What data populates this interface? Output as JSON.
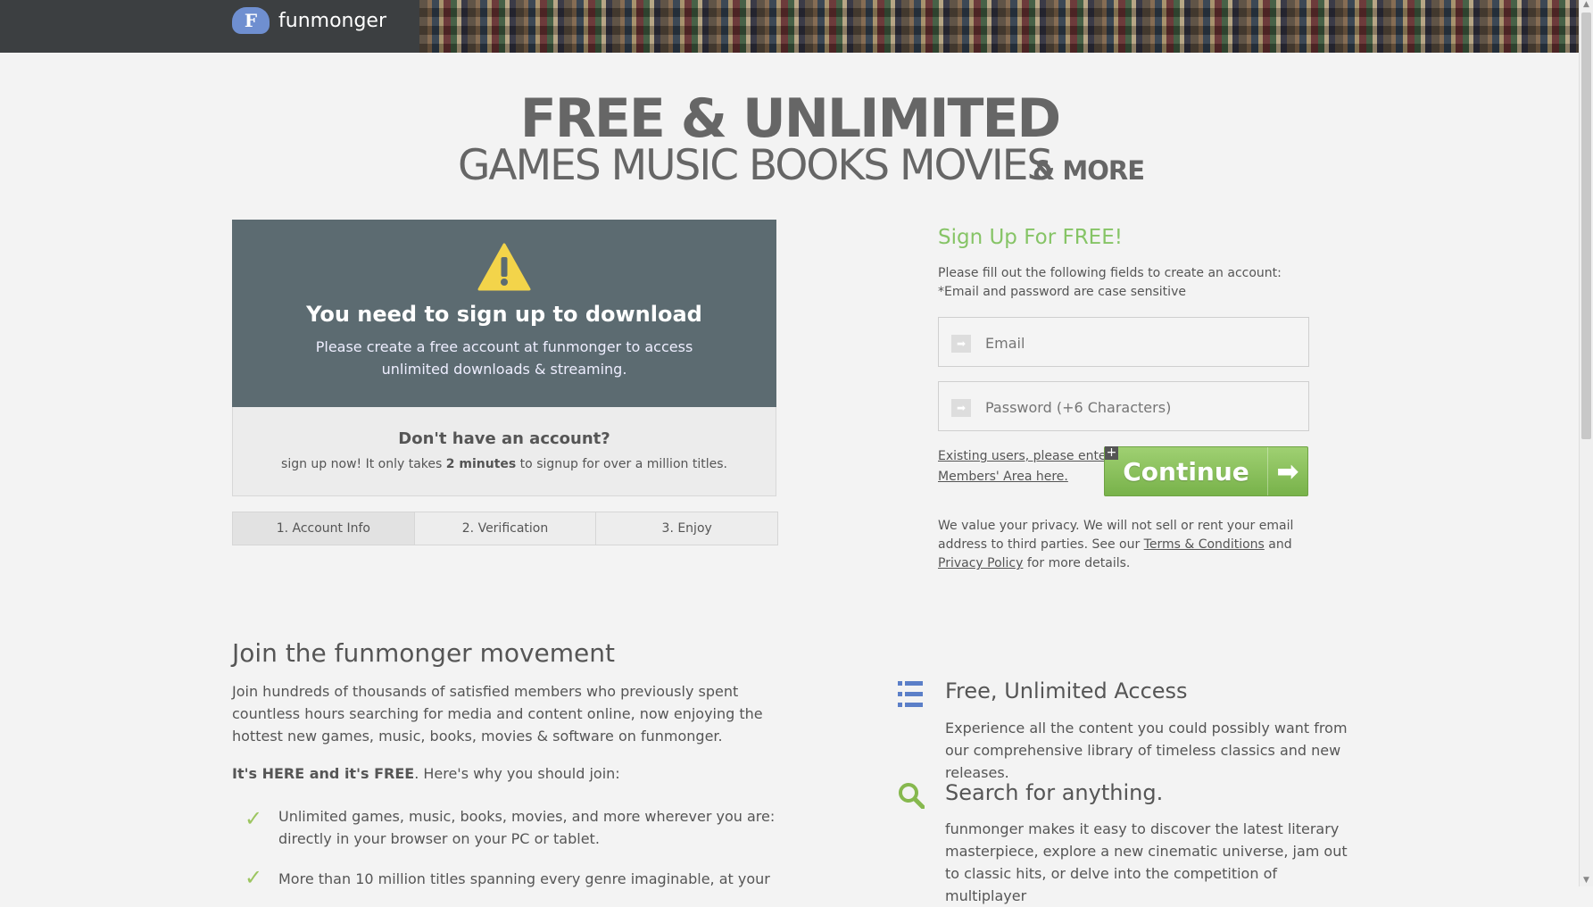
{
  "header": {
    "logo_letter": "F",
    "brand": "funmonger"
  },
  "hero": {
    "line1": "FREE & UNLIMITED",
    "line2": "GAMES MUSIC BOOKS MOVIES",
    "line3": "& MORE"
  },
  "notice": {
    "title": "You need to sign up to download",
    "subtitle_1": "Please create a free account at funmonger to access",
    "subtitle_2": "unlimited downloads & streaming.",
    "question": "Don't have an account?",
    "sub_pre": "sign up now! It only takes ",
    "sub_bold": "2 minutes",
    "sub_post": " to signup for over a million titles."
  },
  "steps": [
    "1. Account Info",
    "2. Verification",
    "3. Enjoy"
  ],
  "signup": {
    "title": "Sign Up For FREE!",
    "line1": "Please fill out the following fields to create an account:",
    "line2": "*Email and password are case sensitive",
    "email_placeholder": "Email",
    "password_placeholder": "Password (+6 Characters)",
    "existing_1": "Existing users, please enter",
    "existing_2": "Members' Area here.",
    "continue_label": "Continue",
    "privacy_pre": "We value your privacy. We will not sell or rent your email address to third parties. See our ",
    "terms_link": "Terms & Conditions",
    "privacy_mid": " and ",
    "privacy_link": "Privacy Policy",
    "privacy_post": " for more details."
  },
  "join": {
    "title": "Join the funmonger movement",
    "paragraph": "Join hundreds of thousands of satisfied members who previously spent countless hours searching for media and content online, now enjoying the hottest new games, music, books, movies & software on funmonger.",
    "why_bold": "It's HERE and it's FREE",
    "why_rest": ". Here's why you should join:",
    "bullets": [
      "Unlimited games, music, books, movies, and more wherever you are: directly in your browser on your PC or tablet.",
      "More than 10 million titles spanning every genre imaginable, at your"
    ]
  },
  "features": [
    {
      "icon": "list-icon",
      "title": "Free, Unlimited Access",
      "desc": "Experience all the content you could possibly want from our comprehensive library of timeless classics and new releases."
    },
    {
      "icon": "search-icon",
      "title": "Search for anything.",
      "desc": "funmonger makes it easy to discover the latest literary masterpiece, explore a new cinematic universe, jam out to classic hits, or delve into the competition of multiplayer"
    }
  ],
  "colors": {
    "accent_green": "#86c466",
    "panel": "#5c6b71",
    "icon_blue": "#5b7fc8"
  }
}
